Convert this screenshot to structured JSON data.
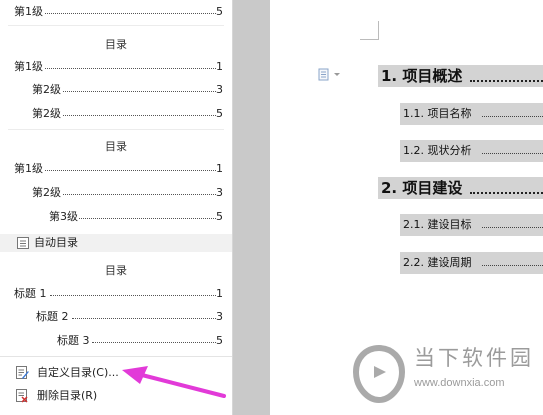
{
  "toc_panel": {
    "top_partial": {
      "label": "第1级",
      "page": "5"
    },
    "style1": {
      "title": "目录",
      "entries": [
        {
          "label": "第1级",
          "page": "1"
        },
        {
          "label": "第2级",
          "page": "3"
        },
        {
          "label": "第2级",
          "page": "5"
        }
      ]
    },
    "style2": {
      "title": "目录",
      "entries": [
        {
          "label": "第1级",
          "page": "1"
        },
        {
          "label": "第2级",
          "page": "3"
        },
        {
          "label": "第3级",
          "page": "5"
        }
      ]
    },
    "auto_section": {
      "label": "自动目录"
    },
    "style3": {
      "title": "目录",
      "entries": [
        {
          "label": "标题 1",
          "page": "1"
        },
        {
          "label": "标题 2",
          "page": "3"
        },
        {
          "label": "标题 3",
          "page": "5"
        }
      ]
    },
    "menu": {
      "custom_label": "自定义目录(C)...",
      "delete_label": "删除目录(R)"
    }
  },
  "document": {
    "headings": [
      {
        "text": "1. 项目概述"
      },
      {
        "text": "1.1. 项目名称"
      },
      {
        "text": "1.2. 现状分析"
      },
      {
        "text": "2. 项目建设"
      },
      {
        "text": "2.1. 建设目标"
      },
      {
        "text": "2.2. 建设周期"
      }
    ]
  },
  "watermark": {
    "brand": "当下软件园",
    "url": "www.downxia.com"
  },
  "colors": {
    "arrow": "#e23ad8",
    "highlight": "#d3d3d3",
    "gutter": "#c9c9c9",
    "logo": "#aaaaaa"
  }
}
